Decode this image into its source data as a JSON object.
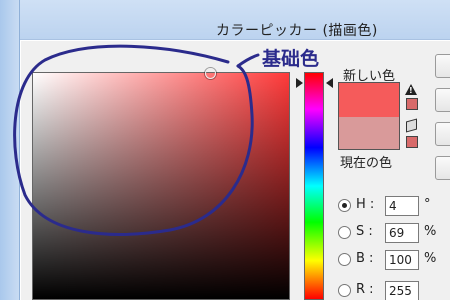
{
  "window": {
    "title": "カラーピッカー (描画色)"
  },
  "annotation": {
    "label": "基础色",
    "color": "#2b2b8c"
  },
  "swatch": {
    "new_label": "新しい色",
    "current_label": "現在の色",
    "new_color": "#f55b5b",
    "current_color": "#d99a9a"
  },
  "hsb": [
    {
      "label": "H :",
      "value": "4",
      "unit": "°",
      "selected": true
    },
    {
      "label": "S :",
      "value": "69",
      "unit": "%",
      "selected": false
    },
    {
      "label": "B :",
      "value": "100",
      "unit": "%",
      "selected": false
    }
  ],
  "rgb": [
    {
      "label": "R :",
      "value": "255",
      "unit": ""
    }
  ],
  "colors": {
    "hue": "#ff3a3a",
    "warning_swatch": "#d86a6a",
    "web_swatch": "#d86a6a"
  }
}
